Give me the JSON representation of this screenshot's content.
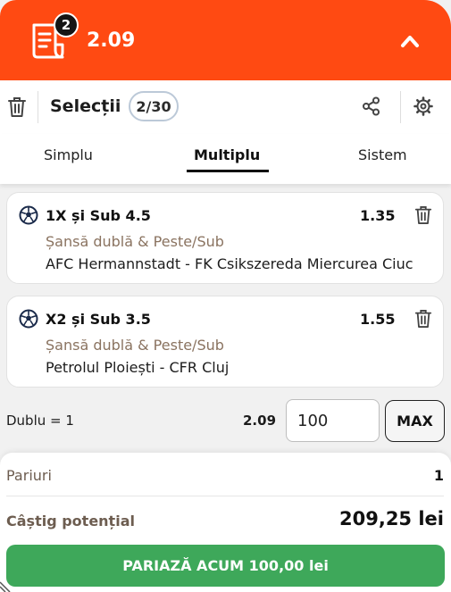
{
  "header": {
    "badge_count": "2",
    "total_odds": "2.09",
    "icons": {
      "slip": "betslip-icon",
      "collapse": "chevron-up-icon"
    }
  },
  "toolbar": {
    "title": "Selecții",
    "count": "2/30",
    "icons": {
      "delete": "trash-icon",
      "share": "share-icon",
      "settings": "gear-icon"
    }
  },
  "tabs": [
    {
      "label": "Simplu",
      "active": false
    },
    {
      "label": "Multiplu",
      "active": true
    },
    {
      "label": "Sistem",
      "active": false
    }
  ],
  "selections": [
    {
      "pick": "1X și Sub 4.5",
      "odd": "1.35",
      "market": "Șansă dublă & Peste/Sub",
      "match": "AFC Hermannstadt - FK Csikszereda Miercurea Ciuc"
    },
    {
      "pick": "X2 și Sub 3.5",
      "odd": "1.55",
      "market": "Șansă dublă & Peste/Sub",
      "match": "Petrolul Ploiești - CFR Cluj"
    }
  ],
  "stake_row": {
    "label": "Dublu = 1",
    "odds": "2.09",
    "stake_value": "100",
    "max_label": "MAX"
  },
  "summary": {
    "bets_label": "Pariuri",
    "bets_value": "1",
    "win_label": "Câștig potențial",
    "win_value": "209,25 lei",
    "place_bet_label": "PARIAZĂ ACUM 100,00 lei"
  },
  "colors": {
    "header_bg": "#ff4a12",
    "bet_button": "#3ea85a",
    "market_text": "#8a7360"
  }
}
